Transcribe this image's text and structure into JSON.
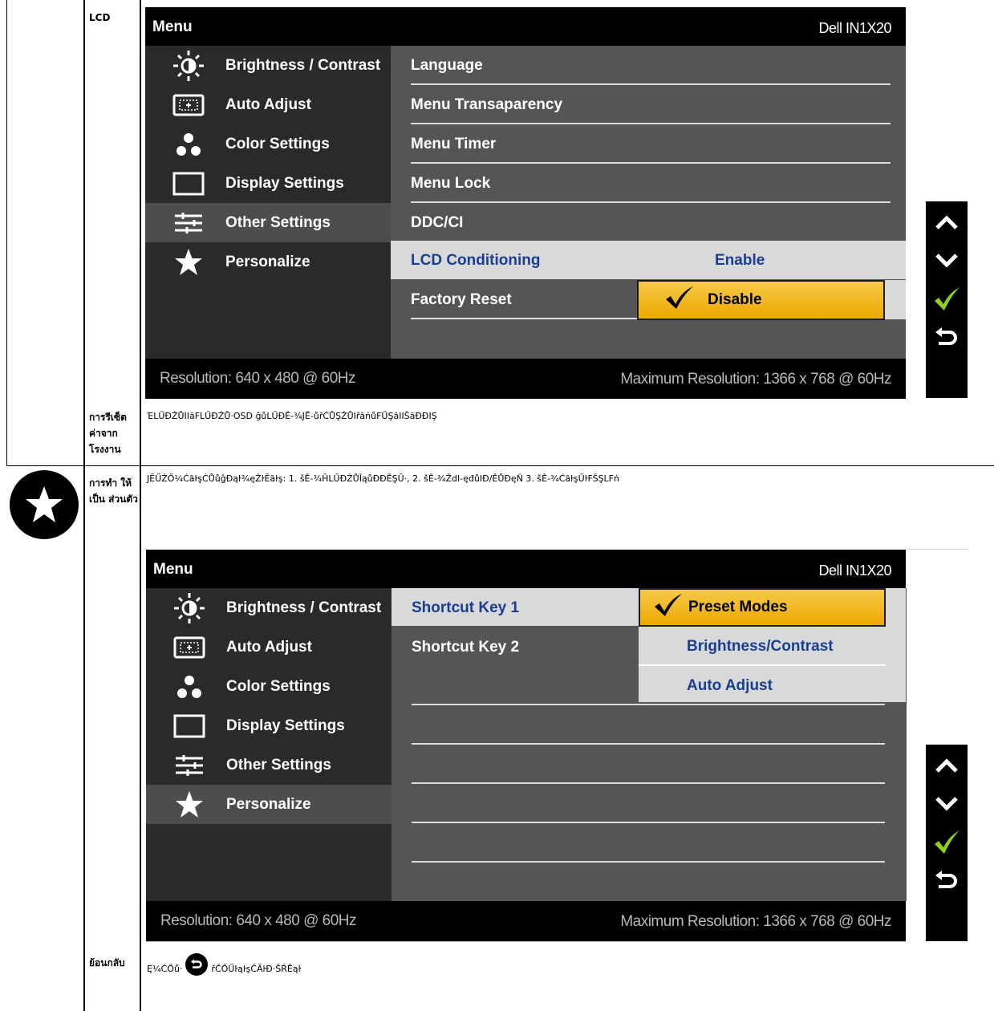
{
  "rows": {
    "lcd_label": "LCD",
    "factory_label": "การรีเซ็ต ค่าจาก โรงงาน",
    "factory_desc": "ΈLŰĐŹŮIIăFLŰĐŹŮ·OSD ĝůLŰĐĚ-¾JĚ-ůřĆŮŞŹŮIřăńůFŰŞăIIŠăĐĐIŞ",
    "personalize_label": "การทำ ให้เป็น ส่วนตัว",
    "personalize_desc": "JĔŰŹŐ¼ĆăŀşĆŮůĝĐąŀ¾ęŹŀĔăŀş:  1. šĚ-¾ĤLŰĐŹŮĪąůĐĐĚŞŰ·,  2. šĚ-¾ŽdI-ęđůIĐ/ĚŮĐęŇ 3. šĚ-¾ĆăŀşŰŀFŠŞLFń",
    "back_label": "ย้อนกลับ",
    "back_desc_pre": "Ę¼ĆŐů·",
    "back_desc_post": "řĈŐŰŀąŀşĈĂŀĐ·ŠŔĚąŀ"
  },
  "osd1": {
    "title": "Menu",
    "model": "Dell IN1X20",
    "menu": [
      {
        "label": "Brightness / Contrast",
        "icon": "brightness-icon"
      },
      {
        "label": "Auto Adjust",
        "icon": "auto-adjust-icon"
      },
      {
        "label": "Color Settings",
        "icon": "color-settings-icon"
      },
      {
        "label": "Display Settings",
        "icon": "display-settings-icon"
      },
      {
        "label": "Other Settings",
        "icon": "other-settings-icon"
      },
      {
        "label": "Personalize",
        "icon": "star-icon"
      }
    ],
    "submenu": [
      "Language",
      "Menu Transaparency",
      "Menu Timer",
      "Menu Lock",
      "DDC/CI",
      "LCD Conditioning",
      "Factory Reset"
    ],
    "option_enable": "Enable",
    "option_disable": "Disable",
    "resolution": "Resolution:  640 x 480 @ 60Hz",
    "max_resolution": "Maximum Resolution: 1366 x 768 @ 60Hz"
  },
  "osd2": {
    "title": "Menu",
    "model": "Dell IN1X20",
    "menu": [
      {
        "label": "Brightness / Contrast",
        "icon": "brightness-icon"
      },
      {
        "label": "Auto Adjust",
        "icon": "auto-adjust-icon"
      },
      {
        "label": "Color Settings",
        "icon": "color-settings-icon"
      },
      {
        "label": "Display Settings",
        "icon": "display-settings-icon"
      },
      {
        "label": "Other Settings",
        "icon": "other-settings-icon"
      },
      {
        "label": "Personalize",
        "icon": "star-icon"
      }
    ],
    "submenu": [
      "Shortcut Key 1",
      "Shortcut Key 2"
    ],
    "options": [
      "Preset Modes",
      "Brightness/Contrast",
      "Auto Adjust"
    ],
    "resolution": "Resolution:  640 x 480 @ 60Hz",
    "max_resolution": "Maximum Resolution: 1366 x 768 @ 60Hz"
  },
  "nav_icons": [
    "up-arrow-icon",
    "down-arrow-icon",
    "checkmark-icon",
    "back-icon"
  ],
  "colors": {
    "highlight_yellow": "#eda900",
    "selected_blue": "#1b3f8f",
    "check_green": "#8fd118"
  }
}
